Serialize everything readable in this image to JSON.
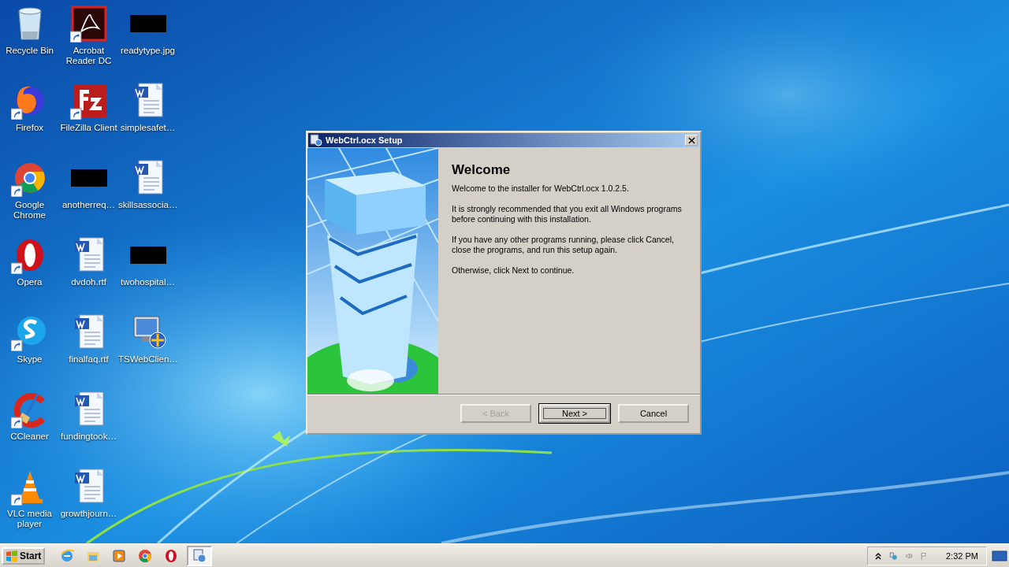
{
  "desktop": {
    "columns": [
      [
        {
          "label": "Recycle Bin",
          "kind": "recycle",
          "shortcut": false
        },
        {
          "label": "Firefox",
          "kind": "firefox",
          "shortcut": true
        },
        {
          "label": "Google Chrome",
          "kind": "chrome",
          "shortcut": true
        },
        {
          "label": "Opera",
          "kind": "opera",
          "shortcut": true
        },
        {
          "label": "Skype",
          "kind": "skype",
          "shortcut": true
        },
        {
          "label": "CCleaner",
          "kind": "ccleaner",
          "shortcut": true
        },
        {
          "label": "VLC media player",
          "kind": "vlc",
          "shortcut": true
        }
      ],
      [
        {
          "label": "Acrobat Reader DC",
          "kind": "acrobat",
          "shortcut": true
        },
        {
          "label": "FileZilla Client",
          "kind": "filezilla",
          "shortcut": true
        },
        {
          "label": "anotherreq…",
          "kind": "redacted"
        },
        {
          "label": "dvdoh.rtf",
          "kind": "word",
          "shortcut": false
        },
        {
          "label": "finalfaq.rtf",
          "kind": "word",
          "shortcut": false
        },
        {
          "label": "fundingtook…",
          "kind": "word",
          "shortcut": false
        },
        {
          "label": "growthjourn…",
          "kind": "word",
          "shortcut": false
        }
      ],
      [
        {
          "label": "readytype.jpg",
          "kind": "redacted"
        },
        {
          "label": "simplesafet…",
          "kind": "word",
          "shortcut": false
        },
        {
          "label": "skillsassocia…",
          "kind": "word",
          "shortcut": false
        },
        {
          "label": "twohospital…",
          "kind": "redacted"
        },
        {
          "label": "TSWebClien…",
          "kind": "monitor",
          "shortcut": false
        }
      ]
    ]
  },
  "dialog": {
    "title": "WebCtrl.ocx Setup",
    "heading": "Welcome",
    "paragraphs": [
      "Welcome to the installer for WebCtrl.ocx 1.0.2.5.",
      "It is strongly recommended that you exit all Windows programs before continuing with this installation.",
      "If you have any other programs running, please click Cancel, close the programs, and run this setup again.",
      "Otherwise, click Next to continue."
    ],
    "buttons": [
      {
        "label": "< Back",
        "disabled": true,
        "default": false
      },
      {
        "label": "Next >",
        "disabled": false,
        "default": true
      },
      {
        "label": "Cancel",
        "disabled": false,
        "default": false
      }
    ]
  },
  "taskbar": {
    "start": "Start",
    "quick_launch": [
      {
        "kind": "ie"
      },
      {
        "kind": "explorer"
      },
      {
        "kind": "media"
      },
      {
        "kind": "chrome"
      },
      {
        "kind": "opera"
      }
    ],
    "tasks": [
      {
        "kind": "setup",
        "selected": true
      }
    ],
    "tray": {
      "clock": "2:32 PM"
    }
  }
}
